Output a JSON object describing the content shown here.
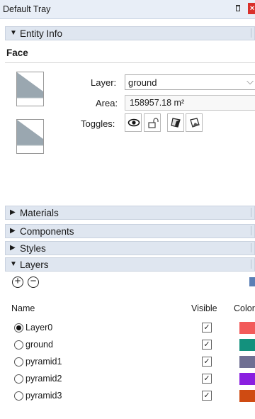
{
  "tray": {
    "title": "Default Tray"
  },
  "panels": {
    "entity_info": "Entity Info",
    "materials": "Materials",
    "components": "Components",
    "styles": "Styles",
    "layers": "Layers"
  },
  "entity": {
    "type": "Face",
    "layer_label": "Layer:",
    "layer_value": "ground",
    "area_label": "Area:",
    "area_value": "158957.18 m²",
    "toggles_label": "Toggles:"
  },
  "layers_table": {
    "headers": {
      "name": "Name",
      "visible": "Visible",
      "color": "Color"
    },
    "rows": [
      {
        "name": "Layer0",
        "active": true,
        "visible": true,
        "color": "#f25a5a"
      },
      {
        "name": "ground",
        "active": false,
        "visible": true,
        "color": "#13917d"
      },
      {
        "name": "pyramid1",
        "active": false,
        "visible": true,
        "color": "#6f6f93"
      },
      {
        "name": "pyramid2",
        "active": false,
        "visible": true,
        "color": "#8a1fe0"
      },
      {
        "name": "pyramid3",
        "active": false,
        "visible": true,
        "color": "#cf4b12"
      }
    ]
  },
  "icons": {
    "collapse": "triangle-down",
    "expand": "triangle-right",
    "add_layer": "plus-circle",
    "delete_layer": "minus-circle",
    "check": "✓"
  }
}
